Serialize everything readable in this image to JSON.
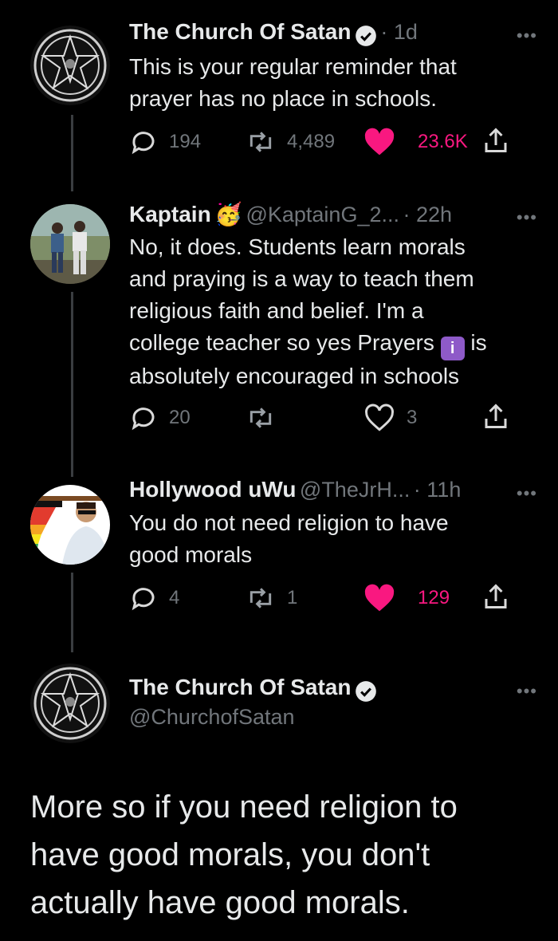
{
  "tweets": [
    {
      "author": "The Church Of Satan",
      "verified": true,
      "meta": "· 1d",
      "text_lines": [
        "This is your regular reminder that",
        "prayer has no place in schools."
      ],
      "replies": "194",
      "retweets": "4,489",
      "likes": "23.6K",
      "liked": true
    },
    {
      "author": "Kaptain",
      "emoji": "🥳",
      "handle": "@KaptainG_2...",
      "meta": "· 22h",
      "text_lines": [
        "No, it does. Students learn morals",
        "and praying is a way to teach them",
        "religious faith and belief. I'm a",
        "college teacher so yes Prayers",
        "absolutely encouraged in schools"
      ],
      "inline_emoji": "i",
      "inline_after": "is",
      "replies": "20",
      "retweets": "",
      "likes": "3",
      "liked": false
    },
    {
      "author": "Hollywood uWu",
      "handle": "@TheJrH...",
      "meta": "· 11h",
      "text_lines": [
        "You do not need religion to have",
        "good morals"
      ],
      "replies": "4",
      "retweets": "1",
      "likes": "129",
      "liked": true
    }
  ],
  "main_tweet": {
    "author": "The Church Of Satan",
    "verified": true,
    "handle": "@ChurchofSatan",
    "text_lines": [
      "More so if you need religion to",
      "have good morals, you don't",
      "actually have good morals."
    ]
  },
  "more_label": "•••",
  "colors": {
    "background": "#000000",
    "text": "#e7e9ea",
    "muted": "#71767b",
    "like": "#f91880",
    "line": "#3a3d40"
  }
}
